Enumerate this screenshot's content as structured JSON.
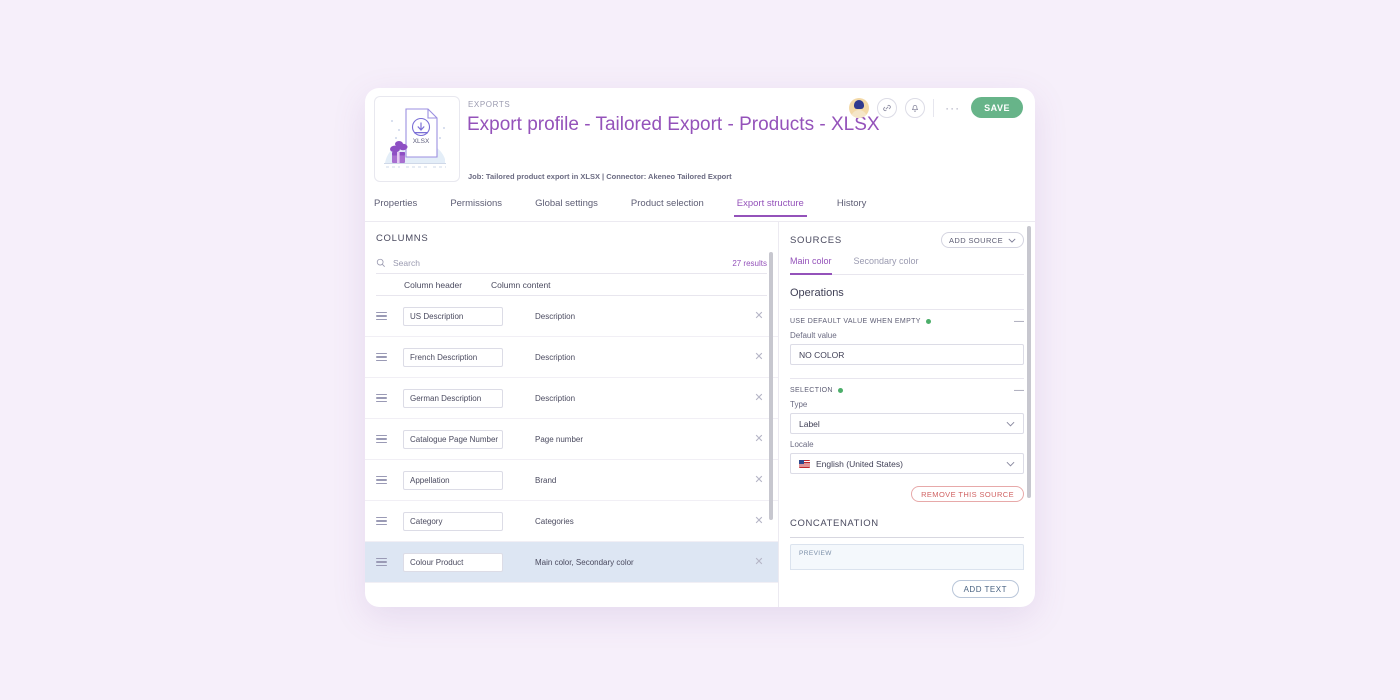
{
  "header": {
    "breadcrumb": "EXPORTS",
    "title": "Export profile - Tailored Export - Products - XLSX",
    "subinfo": "Job: Tailored product export in XLSX | Connector: Akeneo Tailored Export",
    "thumbnail_label": "XLSX",
    "save_label": "SAVE",
    "more_label": "···",
    "accent_color": "#9452ba",
    "save_color": "#67b489"
  },
  "tabs": [
    {
      "label": "Properties",
      "active": false
    },
    {
      "label": "Permissions",
      "active": false
    },
    {
      "label": "Global settings",
      "active": false
    },
    {
      "label": "Product selection",
      "active": false
    },
    {
      "label": "Export structure",
      "active": true
    },
    {
      "label": "History",
      "active": false
    }
  ],
  "columns_panel": {
    "title": "COLUMNS",
    "search_placeholder": "Search",
    "search_value": "",
    "results_label": "27 results",
    "table_headers": {
      "header": "Column header",
      "content": "Column content"
    },
    "rows": [
      {
        "header": "US Description",
        "content": "Description",
        "selected": false
      },
      {
        "header": "French Description",
        "content": "Description",
        "selected": false
      },
      {
        "header": "German Description",
        "content": "Description",
        "selected": false
      },
      {
        "header": "Catalogue Page Number",
        "content": "Page number",
        "selected": false
      },
      {
        "header": "Appellation",
        "content": "Brand",
        "selected": false
      },
      {
        "header": "Category",
        "content": "Categories",
        "selected": false
      },
      {
        "header": "Colour Product",
        "content": "Main color, Secondary color",
        "selected": true
      }
    ]
  },
  "sources_panel": {
    "title": "SOURCES",
    "add_source_label": "ADD SOURCE",
    "tabs": [
      {
        "label": "Main color",
        "active": true
      },
      {
        "label": "Secondary color",
        "active": false
      }
    ],
    "operations_title": "Operations",
    "default_value_op": {
      "label": "USE DEFAULT VALUE WHEN EMPTY",
      "status": "enabled",
      "field_label": "Default value",
      "field_value": "NO COLOR",
      "collapse_label": "—"
    },
    "selection_op": {
      "label": "SELECTION",
      "status": "enabled",
      "type_label": "Type",
      "type_value": "Label",
      "locale_label": "Locale",
      "locale_value": "English (United States)",
      "collapse_label": "—"
    },
    "remove_source_label": "REMOVE THIS SOURCE",
    "concatenation": {
      "title": "CONCATENATION",
      "preview_label": "PREVIEW"
    },
    "add_text_label": "ADD TEXT"
  }
}
